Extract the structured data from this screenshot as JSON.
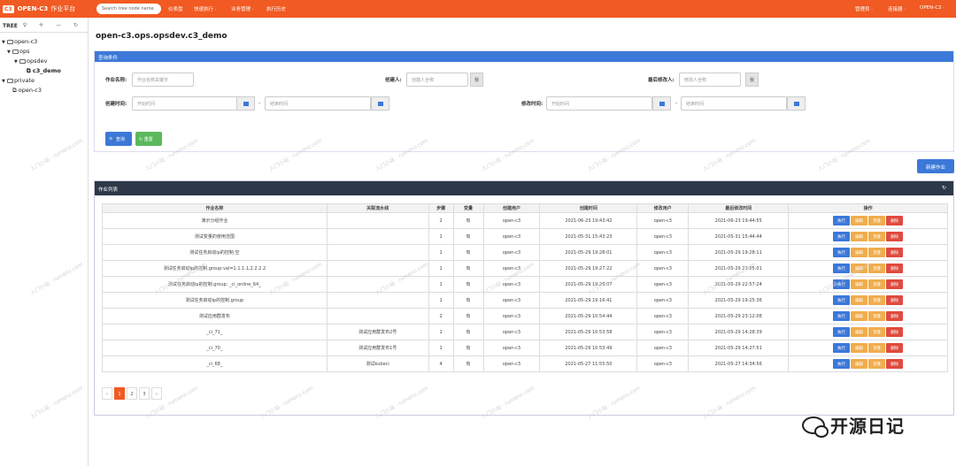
{
  "topbar": {
    "logo_mark": "C3",
    "app_name": "OPEN-C3",
    "app_sub": "作业平台",
    "search_placeholder": "Search tree node name",
    "nav": [
      "仪表盘",
      "快速执行 ·",
      "业务管理 ·",
      "执行历史"
    ],
    "right": [
      "管理员 ·",
      "连接器 ·",
      "OPEN-C3 ·"
    ]
  },
  "sidebar": {
    "title": "TREE",
    "tools": "♀ ✛ — ↻",
    "nodes": [
      {
        "label": "open-c3",
        "arrow": "▼",
        "folder": true
      },
      {
        "label": "ops",
        "arrow": "▼",
        "folder": true
      },
      {
        "label": "opsdev",
        "arrow": "▼",
        "folder": true
      },
      {
        "label": "c3_demo",
        "arrow": "",
        "folder": false,
        "selected": true
      },
      {
        "label": "private",
        "arrow": "▼",
        "folder": true
      },
      {
        "label": "open-c3",
        "arrow": "",
        "folder": false
      }
    ]
  },
  "page_title": "open-c3.ops.opsdev.c3_demo",
  "query": {
    "header": "查询条件",
    "job_name_label": "作业名称:",
    "job_name_placeholder": "作业名称关键字",
    "creator_label": "创建人:",
    "creator_placeholder": "创建人全称",
    "modifier_label": "最后修改人:",
    "modifier_placeholder": "修改人全称",
    "me_btn": "我",
    "created_label": "创建时间:",
    "modified_label": "修改时间:",
    "start_placeholder": "开始时间",
    "end_placeholder": "结束时间",
    "dash": "-",
    "search_btn": "🔍 查询",
    "reset_btn": "↻ 重置"
  },
  "new_job_btn": "新建作业",
  "list": {
    "header": "作业列表",
    "refresh": "↻",
    "columns": [
      "作业名称",
      "关联流水线",
      "步骤",
      "变量",
      "创建用户",
      "创建时间",
      "修改用户",
      "最后修改时间",
      "操作"
    ],
    "rows": [
      [
        "演示分组作业",
        "",
        "2",
        "有",
        "open-c3",
        "2021-06-23 19:43:42",
        "open-c3",
        "2021-06-23 19:44:55"
      ],
      [
        "测试变量的使用范围",
        "",
        "1",
        "有",
        "open-c3",
        "2021-05-31 15:43:23",
        "open-c3",
        "2021-05-31 15:44:44"
      ],
      [
        "测试任务启动ip的控制.空",
        "",
        "1",
        "有",
        "open-c3",
        "2021-05-29 19:28:01",
        "open-c3",
        "2021-05-29 19:28:11"
      ],
      [
        "测试任务启动ip的控制.group:val=1.1.1.1,2.2.2.2",
        "",
        "1",
        "有",
        "open-c3",
        "2021-05-29 19:27:22",
        "open-c3",
        "2021-05-29 23:05:01"
      ],
      [
        "测试任务启动ip的控制.group: _ci_online_64_",
        "",
        "1",
        "有",
        "open-c3",
        "2021-05-29 19:26:07",
        "open-c3",
        "2021-05-29 22:57:24"
      ],
      [
        "测试任务启动ip的控制.group",
        "",
        "1",
        "有",
        "open-c3",
        "2021-05-29 19:16:41",
        "open-c3",
        "2021-05-29 19:25:36"
      ],
      [
        "测试应用群发布",
        "",
        "2",
        "有",
        "open-c3",
        "2021-05-29 10:54:44",
        "open-c3",
        "2021-05-29 23:12:08"
      ],
      [
        "_ci_71_",
        "测试应用群发布2号",
        "1",
        "有",
        "open-c3",
        "2021-05-29 10:53:58",
        "open-c3",
        "2021-05-29 14:28:39"
      ],
      [
        "_ci_70_",
        "测试应用群发布1号",
        "1",
        "有",
        "open-c3",
        "2021-05-29 10:53:49",
        "open-c3",
        "2021-05-29 14:27:51"
      ],
      [
        "_ci_68_",
        "测试kubeci",
        "4",
        "有",
        "open-c3",
        "2021-05-27 11:55:50",
        "open-c3",
        "2021-05-27 14:34:56"
      ]
    ],
    "actions": [
      "执行",
      "编辑",
      "克隆",
      "删除"
    ]
  },
  "pagination": [
    "‹",
    "1",
    "2",
    "3",
    "›"
  ],
  "watermark": "入门小站 · rumenz.com",
  "wechat_brand": "开源日记",
  "colors": {
    "brand": "#f15a22",
    "primary": "#3c78d8",
    "warning": "#f0ad4e",
    "danger": "#e04a3f",
    "success": "#5cb85c"
  }
}
